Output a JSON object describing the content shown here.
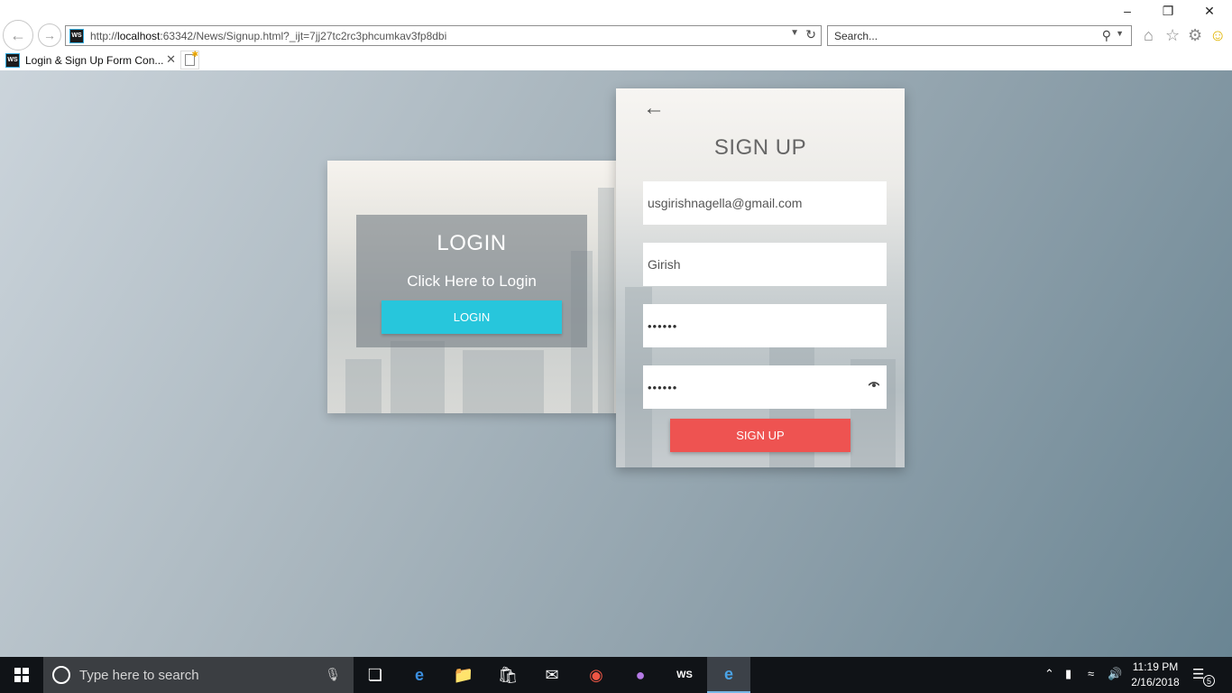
{
  "browser": {
    "url_prefix": "http://",
    "url_host": "localhost",
    "url_rest": ":63342/News/Signup.html?_ijt=7jj27tc2rc3phcumkav3fp8dbi",
    "search_placeholder": "Search...",
    "tab_title": "Login & Sign Up Form Con...",
    "site_icon_label": "WS"
  },
  "login": {
    "title": "LOGIN",
    "subtitle": "Click Here to Login",
    "button": "LOGIN"
  },
  "signup": {
    "title": "SIGN UP",
    "email_value": "usgirishnagella@gmail.com",
    "name_value": "Girish",
    "password_value": "••••••",
    "confirm_value": "••••••",
    "button": "SIGN UP"
  },
  "taskbar": {
    "search_placeholder": "Type here to search",
    "time": "11:19 PM",
    "date": "2/16/2018",
    "notification_count": "5",
    "apps": [
      "task-view-icon",
      "edge-icon",
      "file-explorer-icon",
      "store-icon",
      "mail-icon",
      "chrome-icon",
      "github-icon",
      "webstorm-icon",
      "internet-explorer-icon"
    ]
  },
  "colors": {
    "login_button": "#27c6dc",
    "signup_button": "#ee5351"
  }
}
